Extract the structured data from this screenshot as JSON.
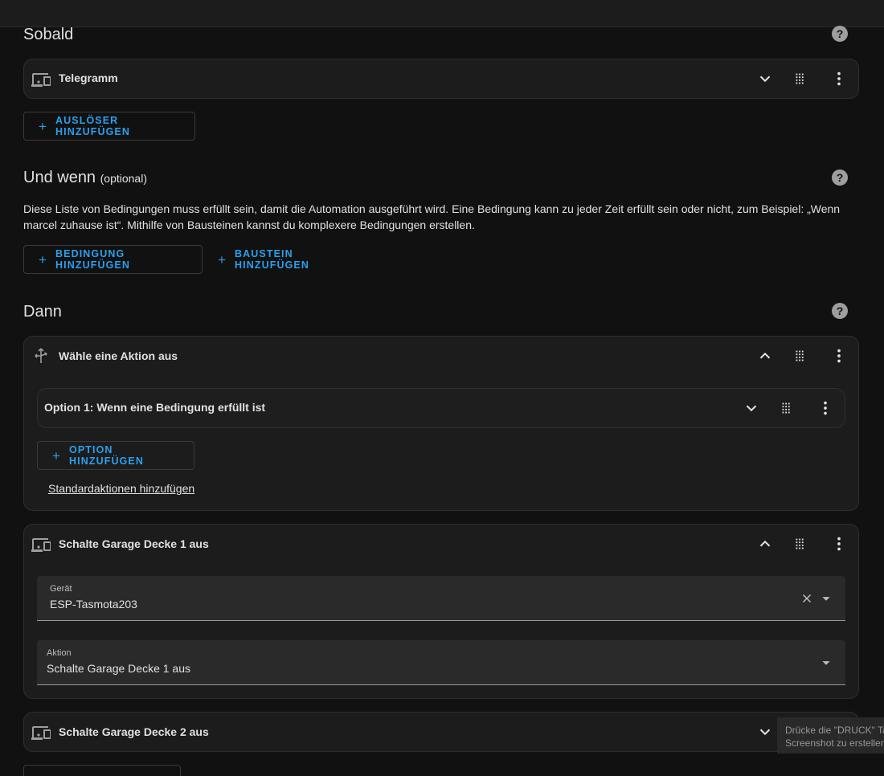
{
  "sections": {
    "trigger": {
      "title": "Sobald"
    },
    "condition": {
      "title": "Und wenn",
      "optional": "(optional)",
      "description": "Diese Liste von Bedingungen muss erfüllt sein, damit die Automation ausgeführt wird. Eine Bedingung kann zu jeder Zeit erfüllt sein oder nicht, zum Beispiel: „Wenn marcel zuhause ist“. Mithilfe von Bausteinen kannst du komplexere Bedingungen erstellen."
    },
    "action": {
      "title": "Dann"
    }
  },
  "help_glyph": "?",
  "triggers": [
    {
      "title": "Telegramm",
      "icon": "device-icon"
    }
  ],
  "buttons": {
    "add_trigger": "AUSLÖSER HINZUFÜGEN",
    "add_condition": "BEDINGUNG HINZUFÜGEN",
    "add_building_block": "BAUSTEIN HINZUFÜGEN",
    "add_option": "OPTION HINZUFÜGEN",
    "plus": "+"
  },
  "choose_action": {
    "title": "Wähle eine Aktion aus",
    "icon": "arrow-decision-icon",
    "option_title": "Option 1: Wenn eine Bedingung erfüllt ist",
    "default_actions_link": "Standardaktionen hinzufügen"
  },
  "device_action_1": {
    "title": "Schalte Garage Decke 1 aus",
    "device_label": "Gerät",
    "device_value": "ESP-Tasmota203",
    "action_label": "Aktion",
    "action_value": "Schalte Garage Decke 1 aus"
  },
  "device_action_2": {
    "title": "Schalte Garage Decke 2 aus"
  },
  "toast": {
    "line1": "Drücke die \"DRUCK\" Ta",
    "line2": "Screenshot zu erstellen"
  },
  "colors": {
    "accent": "#2aa0ef",
    "background": "#111111",
    "card": "#1c1c1c"
  }
}
